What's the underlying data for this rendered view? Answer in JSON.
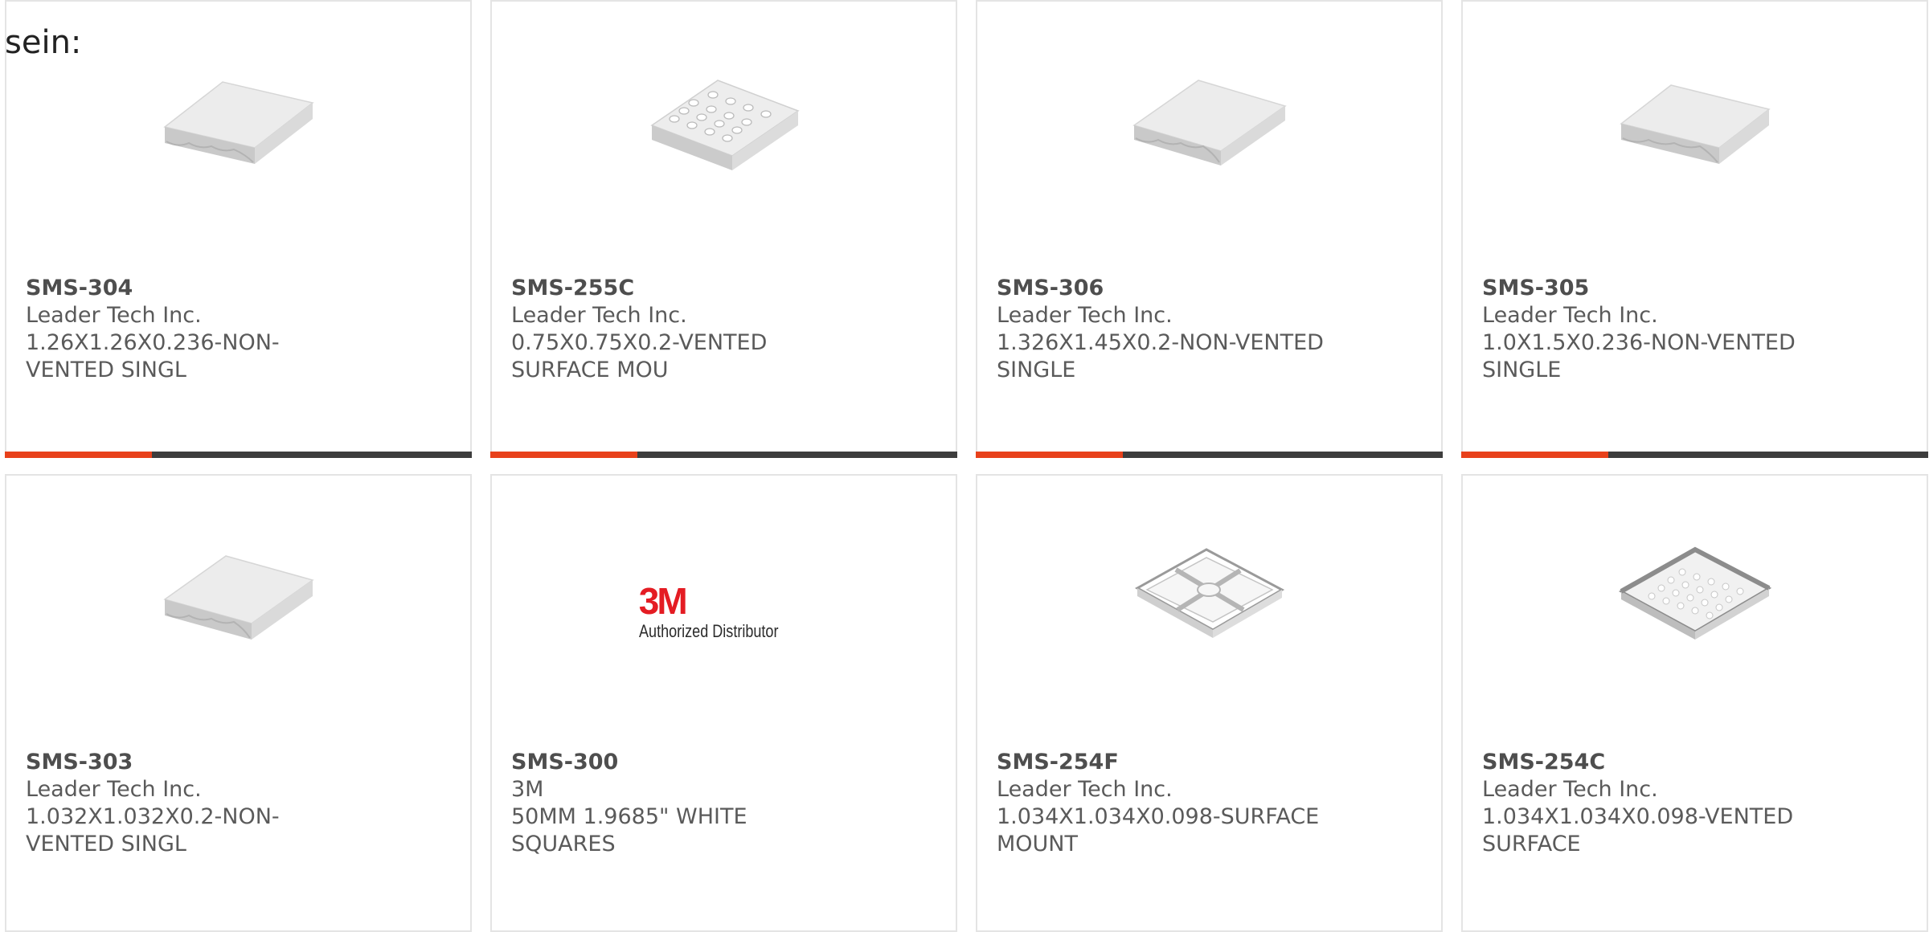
{
  "leading_text": "sein:",
  "colors": {
    "accent": "#e8411b",
    "bar": "#3d3d3d",
    "border": "#e4e4e4",
    "text": "#5a5a5a",
    "brand_3m_red": "#e41c23"
  },
  "products": [
    {
      "part_number": "SMS-304",
      "manufacturer": "Leader Tech Inc.",
      "description": "1.26X1.26X0.236-NON-VENTED SINGL",
      "image": "solid-shield-can-icon"
    },
    {
      "part_number": "SMS-255C",
      "manufacturer": "Leader Tech Inc.",
      "description": "0.75X0.75X0.2-VENTED SURFACE MOU",
      "image": "vented-shield-can-icon"
    },
    {
      "part_number": "SMS-306",
      "manufacturer": "Leader Tech Inc.",
      "description": "1.326X1.45X0.2-NON-VENTED SINGLE",
      "image": "solid-shield-can-icon"
    },
    {
      "part_number": "SMS-305",
      "manufacturer": "Leader Tech Inc.",
      "description": "1.0X1.5X0.236-NON-VENTED SINGLE",
      "image": "solid-shield-can-icon"
    },
    {
      "part_number": "SMS-303",
      "manufacturer": "Leader Tech Inc.",
      "description": "1.032X1.032X0.2-NON-VENTED SINGL",
      "image": "solid-shield-can-icon"
    },
    {
      "part_number": "SMS-300",
      "manufacturer": "3M",
      "description": "50MM 1.9685\" WHITE SQUARES",
      "image": "3m-authorized-distributor-logo",
      "logo_text": "3M",
      "logo_tagline": "Authorized Distributor"
    },
    {
      "part_number": "SMS-254F",
      "manufacturer": "Leader Tech Inc.",
      "description": "1.034X1.034X0.098-SURFACE MOUNT",
      "image": "shield-frame-icon"
    },
    {
      "part_number": "SMS-254C",
      "manufacturer": "Leader Tech Inc.",
      "description": "1.034X1.034X0.098-VENTED SURFACE",
      "image": "vented-shield-cover-icon"
    }
  ]
}
